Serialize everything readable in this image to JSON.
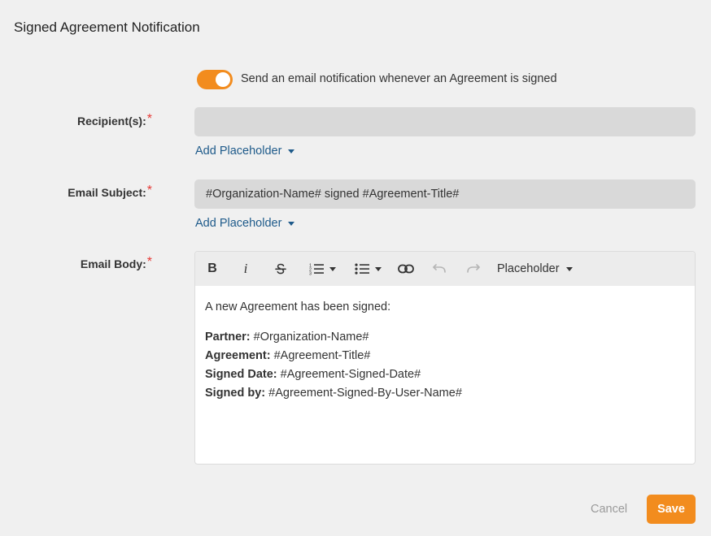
{
  "page": {
    "title": "Signed Agreement Notification"
  },
  "toggle": {
    "enabled": true,
    "label": "Send an email notification whenever an Agreement is signed"
  },
  "recipients": {
    "label": "Recipient(s):",
    "required_mark": "*",
    "value": "",
    "add_placeholder": "Add Placeholder"
  },
  "subject": {
    "label": "Email Subject:",
    "required_mark": "*",
    "value": "#Organization-Name# signed #Agreement-Title#",
    "add_placeholder": "Add Placeholder"
  },
  "body": {
    "label": "Email Body:",
    "required_mark": "*",
    "toolbar": {
      "bold": "B",
      "italic": "i",
      "strikethrough_icon": "strikethrough-icon",
      "ordered_list_icon": "ordered-list-icon",
      "bullet_list_icon": "bullet-list-icon",
      "link_icon": "link-icon",
      "undo_icon": "undo-icon",
      "redo_icon": "redo-icon",
      "placeholder_menu": "Placeholder"
    },
    "intro": "A new Agreement has been signed:",
    "lines": [
      {
        "key": "Partner:",
        "value": "#Organization-Name#"
      },
      {
        "key": "Agreement:",
        "value": "#Agreement-Title#"
      },
      {
        "key": "Signed Date:",
        "value": "#Agreement-Signed-Date#"
      },
      {
        "key": "Signed by:",
        "value": "#Agreement-Signed-By-User-Name#"
      }
    ]
  },
  "footer": {
    "cancel_label": "Cancel",
    "save_label": "Save"
  },
  "colors": {
    "accent": "#f28c1e",
    "link": "#1e5a8a",
    "required": "#e53935"
  }
}
